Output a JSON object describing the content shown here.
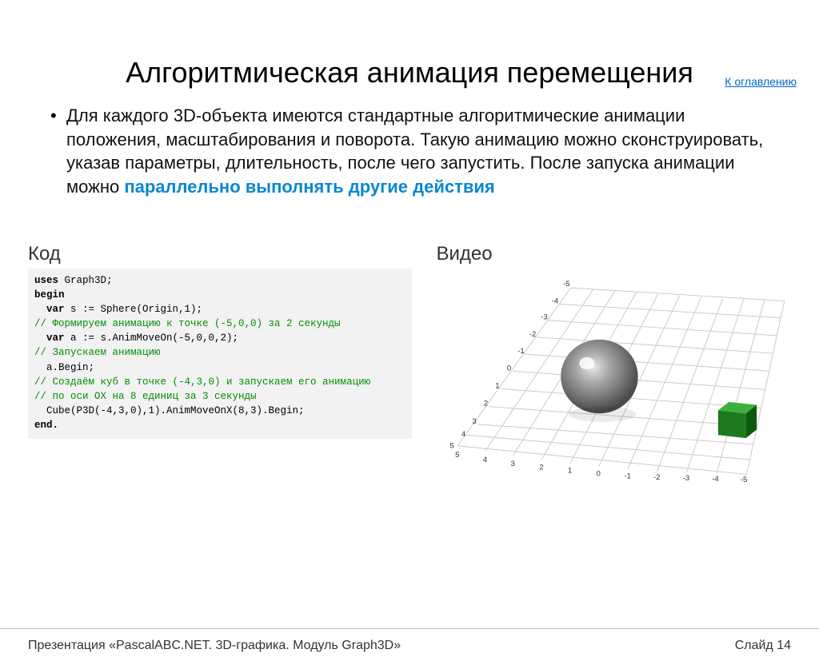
{
  "nav": {
    "toc": "К оглавлению"
  },
  "title": "Алгоритмическая анимация перемещения",
  "intro": {
    "text_plain": "Для каждого 3D-объекта имеются стандартные алгоритмические анимации положения, масштабирования и поворота. Такую анимацию можно сконструировать, указав параметры, длительность, после чего запустить. После запуска анимации можно ",
    "text_highlight": "параллельно выполнять другие действия"
  },
  "labels": {
    "code": "Код",
    "video": "Видео"
  },
  "code": {
    "l1a": "uses",
    "l1b": " Graph3D;",
    "l2": "begin",
    "l3a": "  var",
    "l3b": " s := Sphere(Origin,1);",
    "l4": "// Формируем анимацию к точке (-5,0,0) за 2 секунды",
    "l5a": "  var",
    "l5b": " a := s.AnimMoveOn(-5,0,0,2);",
    "l6": "// Запускаем анимацию",
    "l7": "  a.Begin;",
    "l8": "// Создаём куб в точке (-4,3,0) и запускаем его анимацию",
    "l9": "// по оси OX на 8 единиц за 3 секунды",
    "l10": "  Cube(P3D(-4,3,0),1).AnimMoveOnX(8,3).Begin;",
    "l11": "end."
  },
  "grid": {
    "x_labels": [
      "5",
      "4",
      "3",
      "2",
      "1",
      "0",
      "-1",
      "-2",
      "-3",
      "-4",
      "-5"
    ],
    "z_labels": [
      "-5",
      "-4",
      "-3",
      "-2",
      "-1",
      "0",
      "1",
      "2",
      "3",
      "4",
      "5"
    ]
  },
  "footer": {
    "left": "Презентация «PascalABC.NET. 3D-графика. Модуль Graph3D»",
    "right": "Слайд 14"
  }
}
